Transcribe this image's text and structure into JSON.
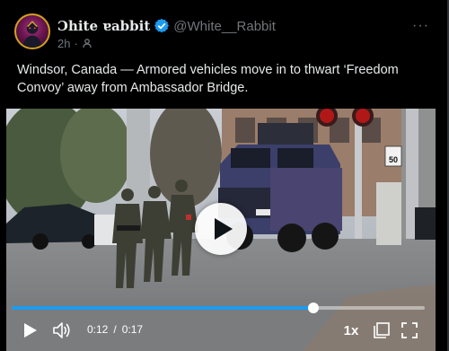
{
  "post": {
    "display_name": "Ɔhite ɐabbit",
    "handle": "@White__Rabbit",
    "time_ago": "2h",
    "dot": "·",
    "text": "Windsor, Canada — Armored vehicles move in to thwart ‘Freedom Convoy’ away from Ambassador Bridge.",
    "more_label": "···"
  },
  "video": {
    "current_time": "0:12",
    "separator": "/",
    "duration": "0:17",
    "progress_fraction": 0.73,
    "speed_label": "1x",
    "speed_sign_top": "SPEED\nLIMIT",
    "speed_sign_number": "50",
    "truck_plate": "",
    "icons": [
      "play-icon",
      "volume-icon",
      "pip-icon",
      "fullscreen-icon"
    ]
  },
  "colors": {
    "background": "#000000",
    "text": "#e7e9ea",
    "secondary": "#71767b",
    "verified": "#1d9bf0",
    "progress": "#1d9bf0"
  }
}
